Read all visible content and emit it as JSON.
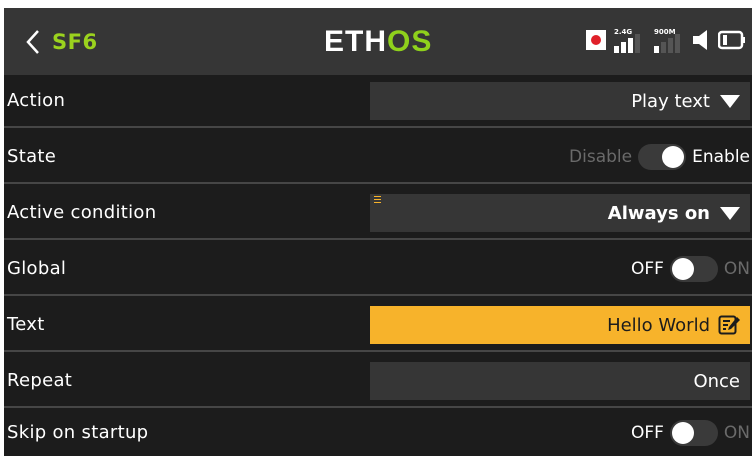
{
  "header": {
    "model_name": "SF6",
    "logo_main": "ETH",
    "logo_accent": "OS",
    "band_24": "2.4G",
    "band_900": "900M"
  },
  "rows": [
    {
      "label": "Action",
      "value": "Play text",
      "type": "dropdown"
    },
    {
      "label": "State",
      "off_text": "Disable",
      "on_text": "Enable",
      "state": "on",
      "type": "toggle"
    },
    {
      "label": "Active condition",
      "value": "Always on",
      "type": "dropdown"
    },
    {
      "label": "Global",
      "off_text": "OFF",
      "on_text": "ON",
      "state": "off",
      "type": "toggle"
    },
    {
      "label": "Text",
      "value": "Hello World",
      "type": "text-edit"
    },
    {
      "label": "Repeat",
      "value": "Once",
      "type": "choice"
    },
    {
      "label": "Skip on startup",
      "off_text": "OFF",
      "on_text": "ON",
      "state": "off",
      "type": "toggle"
    }
  ],
  "colors": {
    "background": "#1c1c1c",
    "header": "#363636",
    "accent_green": "#9bd21e",
    "highlight": "#f7b32b",
    "record_red": "#e0202a"
  },
  "icons": [
    "back-chevron-icon",
    "record-icon",
    "signal-2-4g-icon",
    "signal-900m-icon",
    "speaker-icon",
    "battery-icon",
    "edit-icon",
    "caret-down-icon"
  ]
}
